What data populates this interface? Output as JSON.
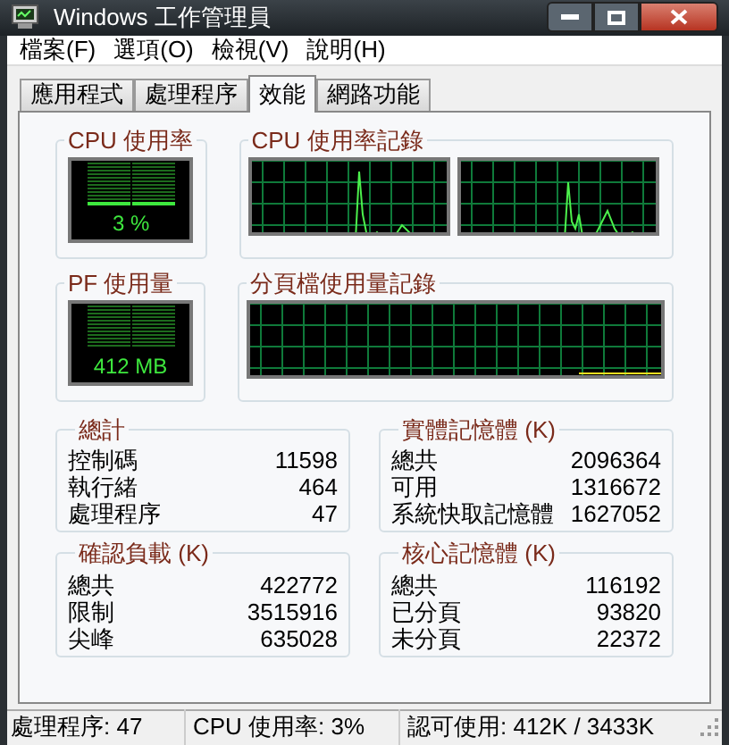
{
  "window": {
    "title": "Windows 工作管理員"
  },
  "menu": [
    "檔案(F)",
    "選項(O)",
    "檢視(V)",
    "說明(H)"
  ],
  "tabs": [
    {
      "label": "應用程式",
      "selected": false
    },
    {
      "label": "處理程序",
      "selected": false
    },
    {
      "label": "效能",
      "selected": true
    },
    {
      "label": "網路功能",
      "selected": false
    }
  ],
  "cpu_usage": {
    "title": "CPU 使用率",
    "reading": "3 %"
  },
  "cpu_history": {
    "title": "CPU 使用率記錄"
  },
  "pf_usage": {
    "title": "PF 使用量",
    "reading": "412 MB"
  },
  "pf_history": {
    "title": "分頁檔使用量記錄"
  },
  "sections": [
    {
      "title": "總計",
      "rows": [
        {
          "label": "控制碼",
          "value": "11598"
        },
        {
          "label": "執行緒",
          "value": "464"
        },
        {
          "label": "處理程序",
          "value": "47"
        }
      ]
    },
    {
      "title": "實體記憶體 (K)",
      "rows": [
        {
          "label": "總共",
          "value": "2096364"
        },
        {
          "label": "可用",
          "value": "1316672"
        },
        {
          "label": "系統快取記憶體",
          "value": "1627052"
        }
      ]
    },
    {
      "title": "確認負載 (K)",
      "rows": [
        {
          "label": "總共",
          "value": "422772"
        },
        {
          "label": "限制",
          "value": "3515916"
        },
        {
          "label": "尖峰",
          "value": "635028"
        }
      ]
    },
    {
      "title": "核心記憶體 (K)",
      "rows": [
        {
          "label": "總共",
          "value": "116192"
        },
        {
          "label": "已分頁",
          "value": "93820"
        },
        {
          "label": "未分頁",
          "value": "22372"
        }
      ]
    }
  ],
  "status_bar": [
    "處理程序: 47",
    "CPU 使用率: 3%",
    "認可使用: 412K / 3433K"
  ]
}
